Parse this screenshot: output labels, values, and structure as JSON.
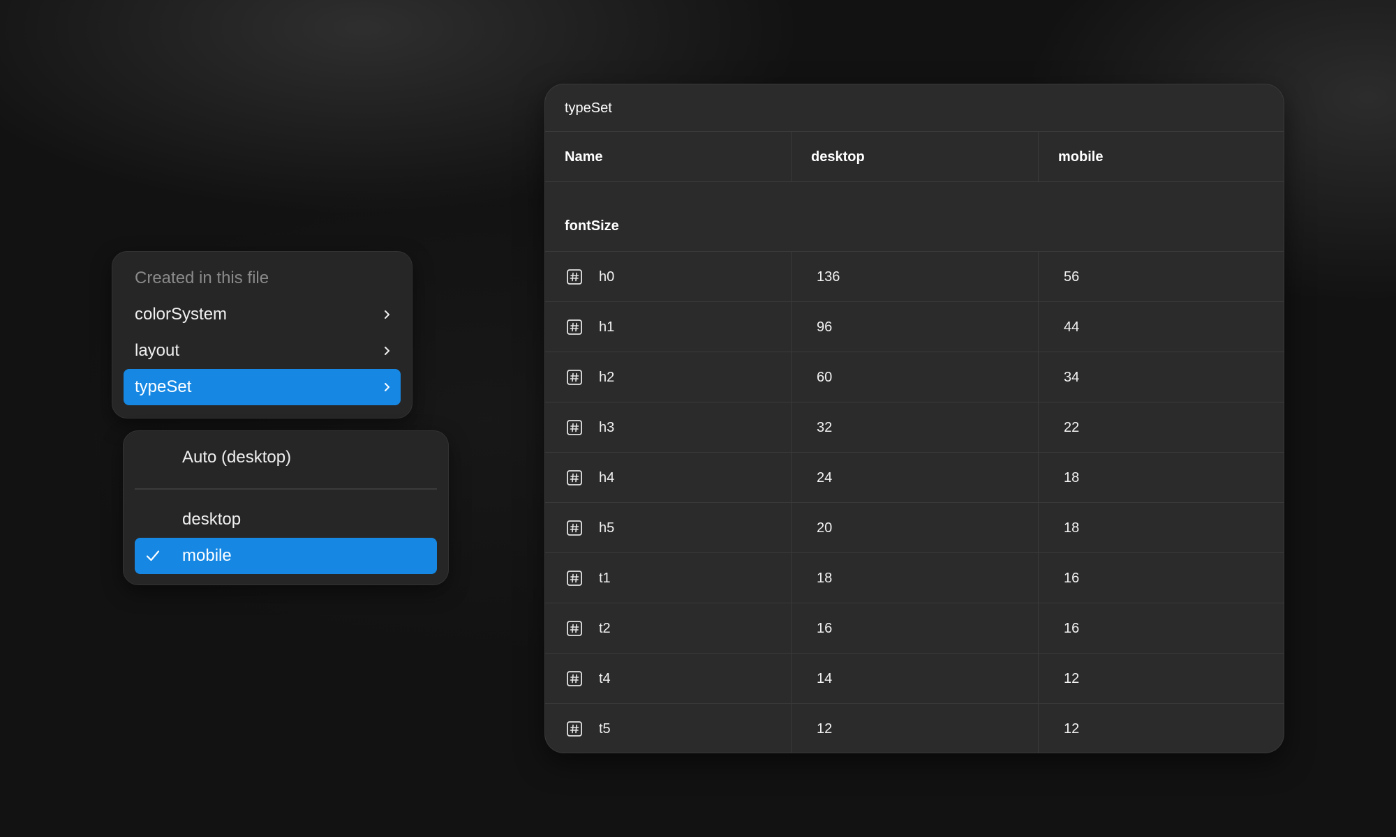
{
  "collections_menu": {
    "header": "Created in this file",
    "items": [
      {
        "label": "colorSystem",
        "icon": "chevron-right-icon"
      },
      {
        "label": "layout",
        "icon": "chevron-right-icon"
      },
      {
        "label": "typeSet",
        "icon": "chevron-right-icon",
        "active": true
      }
    ]
  },
  "modes_menu": {
    "auto": "Auto (desktop)",
    "items": [
      {
        "label": "desktop",
        "checked": false
      },
      {
        "label": "mobile",
        "checked": true
      }
    ]
  },
  "table": {
    "title": "typeSet",
    "columns": [
      "Name",
      "desktop",
      "mobile"
    ],
    "group": "fontSize",
    "rows": [
      {
        "name": "h0",
        "desktop": "136",
        "mobile": "56"
      },
      {
        "name": "h1",
        "desktop": "96",
        "mobile": "44"
      },
      {
        "name": "h2",
        "desktop": "60",
        "mobile": "34"
      },
      {
        "name": "h3",
        "desktop": "32",
        "mobile": "22"
      },
      {
        "name": "h4",
        "desktop": "24",
        "mobile": "18"
      },
      {
        "name": "h5",
        "desktop": "20",
        "mobile": "18"
      },
      {
        "name": "t1",
        "desktop": "18",
        "mobile": "16"
      },
      {
        "name": "t2",
        "desktop": "16",
        "mobile": "16"
      },
      {
        "name": "t4",
        "desktop": "14",
        "mobile": "12"
      },
      {
        "name": "t5",
        "desktop": "12",
        "mobile": "12"
      }
    ],
    "row_icon": "number-variable-icon"
  },
  "colors": {
    "accent": "#1688e4",
    "panel": "#2b2b2b",
    "menu": "#262626",
    "background": "#121212"
  }
}
